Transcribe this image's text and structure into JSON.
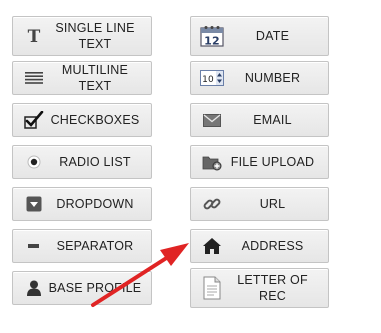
{
  "left_column": [
    {
      "label": "SINGLE LINE TEXT",
      "icon": "text-t-icon"
    },
    {
      "label": "MULTILINE TEXT",
      "icon": "multiline-lines-icon"
    },
    {
      "label": "CHECKBOXES",
      "icon": "checkmark-icon"
    },
    {
      "label": "RADIO LIST",
      "icon": "radio-dot-icon"
    },
    {
      "label": "DROPDOWN",
      "icon": "dropdown-box-icon"
    },
    {
      "label": "SEPARATOR",
      "icon": "dash-icon"
    },
    {
      "label": "BASE PROFILE",
      "icon": "person-icon"
    }
  ],
  "right_column": [
    {
      "label": "DATE",
      "icon": "calendar-icon",
      "icon_text": "12"
    },
    {
      "label": "NUMBER",
      "icon": "number-stepper-icon",
      "icon_text": "10"
    },
    {
      "label": "EMAIL",
      "icon": "envelope-icon"
    },
    {
      "label": "FILE UPLOAD",
      "icon": "folder-upload-icon"
    },
    {
      "label": "URL",
      "icon": "chain-link-icon"
    },
    {
      "label": "ADDRESS",
      "icon": "house-icon"
    },
    {
      "label": "LETTER OF REC",
      "icon": "document-icon"
    }
  ],
  "colors": {
    "button_bg": "#ebebeb",
    "button_border": "#c4c4c4",
    "text": "#222222",
    "annotation_arrow": "#e02424"
  }
}
